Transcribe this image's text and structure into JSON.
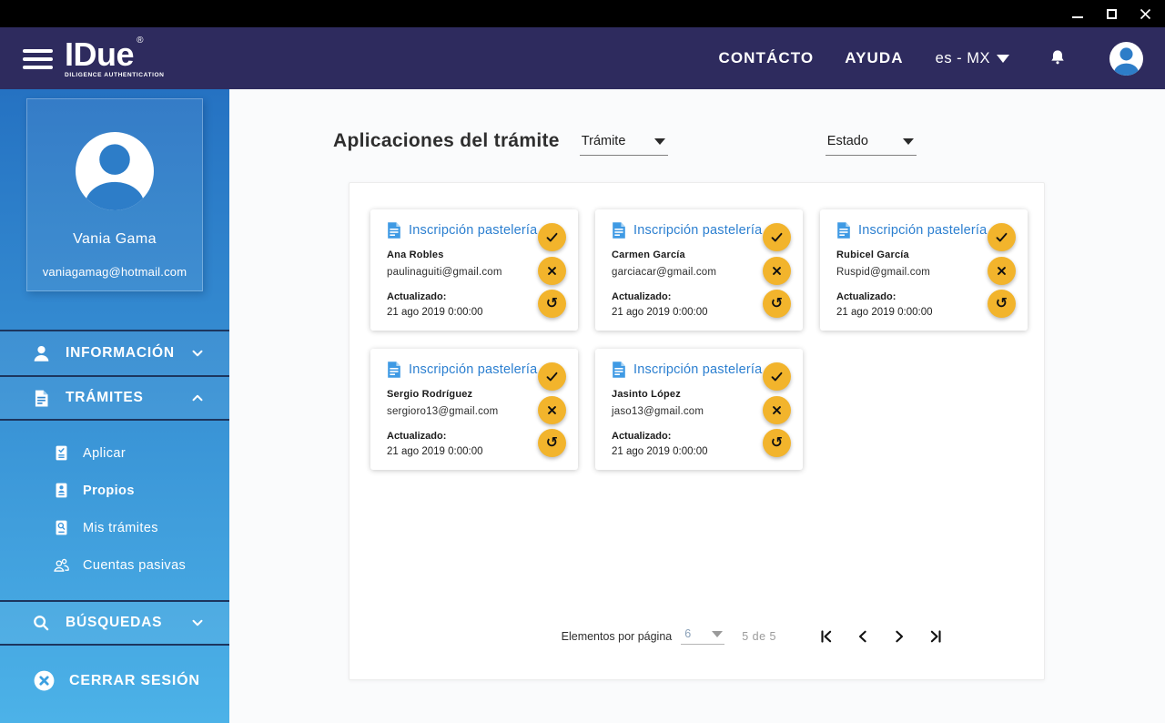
{
  "window": {
    "controls": {
      "minimize": "minimize",
      "maximize": "maximize",
      "close": "close"
    }
  },
  "header": {
    "logo": {
      "title": "IDue",
      "registered": "®",
      "subtitle": "DILIGENCE AUTHENTICATION"
    },
    "contacto": "CONTÁCTO",
    "ayuda": "AYUDA",
    "language": "es - MX"
  },
  "sidebar": {
    "profile": {
      "name": "Vania Gama",
      "email": "vaniagamag@hotmail.com"
    },
    "items": {
      "informacion": "INFORMACIÓN",
      "tramites": "TRÁMITES",
      "busquedas": "BÚSQUEDAS",
      "logout": "CERRAR SESIÓN"
    },
    "tramites_children": [
      {
        "label": "Aplicar"
      },
      {
        "label": "Propios",
        "active": true
      },
      {
        "label": "Mis trámites"
      },
      {
        "label": "Cuentas pasivas"
      }
    ]
  },
  "main": {
    "title": "Aplicaciones del trámite",
    "filters": {
      "tramite": "Trámite",
      "estado": "Estado"
    },
    "cards": [
      {
        "title": "Inscripción pastelería",
        "applicant": "Ana Robles",
        "email": "paulinaguiti@gmail.com",
        "updated_label": "Actualizado:",
        "updated_at": "21 ago 2019 0:00:00"
      },
      {
        "title": "Inscripción pastelería",
        "applicant": "Carmen García",
        "email": "garciacar@gmail.com",
        "updated_label": "Actualizado:",
        "updated_at": "21 ago 2019 0:00:00"
      },
      {
        "title": "Inscripción pastelería",
        "applicant": "Rubicel García",
        "email": "Ruspid@gmail.com",
        "updated_label": "Actualizado:",
        "updated_at": "21 ago 2019 0:00:00"
      },
      {
        "title": "Inscripción pastelería",
        "applicant": "Sergio Rodríguez",
        "email": "sergioro13@gmail.com",
        "updated_label": "Actualizado:",
        "updated_at": "21 ago 2019 0:00:00"
      },
      {
        "title": "Inscripción pastelería",
        "applicant": "Jasinto López",
        "email": "jaso13@gmail.com",
        "updated_label": "Actualizado:",
        "updated_at": "21 ago 2019 0:00:00"
      }
    ],
    "pagination": {
      "label": "Elementos por página",
      "per_page": "6",
      "range": "5 de 5"
    }
  },
  "icons": {
    "approve": "check",
    "reject": "x",
    "undo": "rotate-left",
    "undo_glyph": "↺",
    "notifications": "bell",
    "menu": "hamburger",
    "search": "magnifier",
    "logout": "x-circle",
    "document": "document-with-lines"
  },
  "colors": {
    "header_bg": "#2e2b5e",
    "sidebar_top": "#2572c2",
    "sidebar_bottom": "#4cb2e8",
    "accent_blue": "#2b7fd0",
    "action_yellow": "#f2b42c",
    "divider": "#1c355e"
  }
}
